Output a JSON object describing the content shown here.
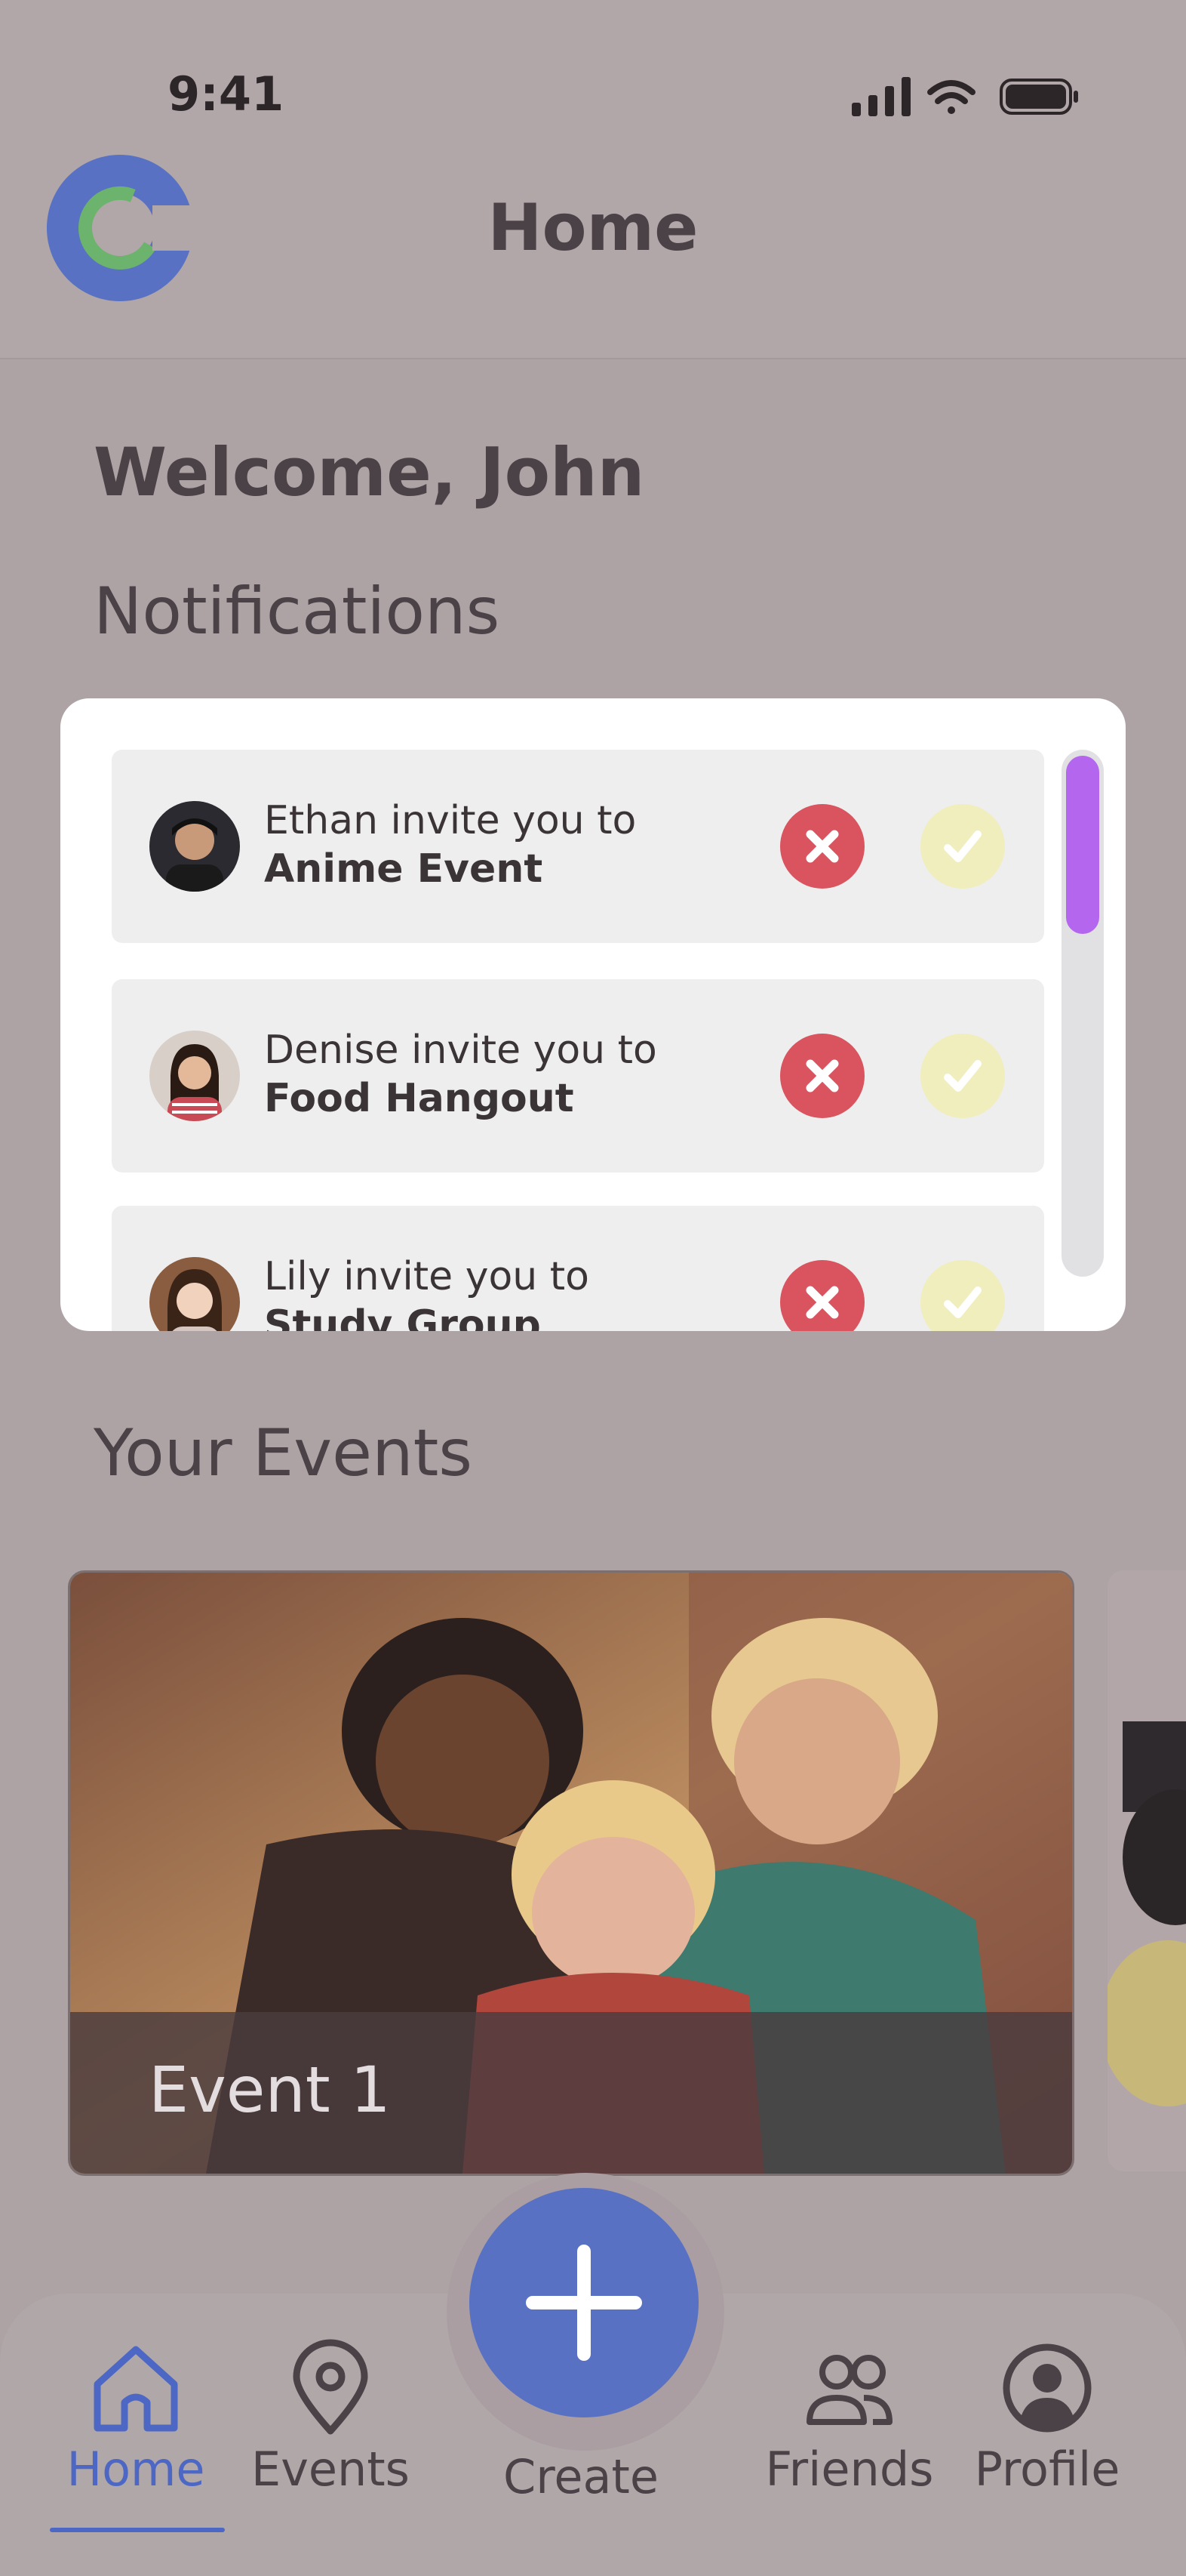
{
  "status_bar": {
    "time": "9:41"
  },
  "header": {
    "title": "Home"
  },
  "welcome": "Welcome, John",
  "notifications": {
    "title": "Notifications",
    "items": [
      {
        "line1": "Ethan invite you to",
        "event": "Anime Event"
      },
      {
        "line1": "Denise invite you to",
        "event": "Food Hangout"
      },
      {
        "line1": "Lily invite you to",
        "event": "Study Group"
      }
    ]
  },
  "events": {
    "title": "Your Events",
    "items": [
      {
        "name": "Event 1"
      }
    ]
  },
  "nav": {
    "items": [
      {
        "label": "Home",
        "icon": "home-icon",
        "active": true
      },
      {
        "label": "Events",
        "icon": "location-pin-icon"
      },
      {
        "label": "Create",
        "icon": "plus-icon"
      },
      {
        "label": "Friends",
        "icon": "friends-icon"
      },
      {
        "label": "Profile",
        "icon": "profile-icon"
      }
    ]
  },
  "colors": {
    "accent": "#4d67c4",
    "decline": "#d9545f",
    "accept": "#f0eebd",
    "scroll_thumb": "#b566ee"
  }
}
